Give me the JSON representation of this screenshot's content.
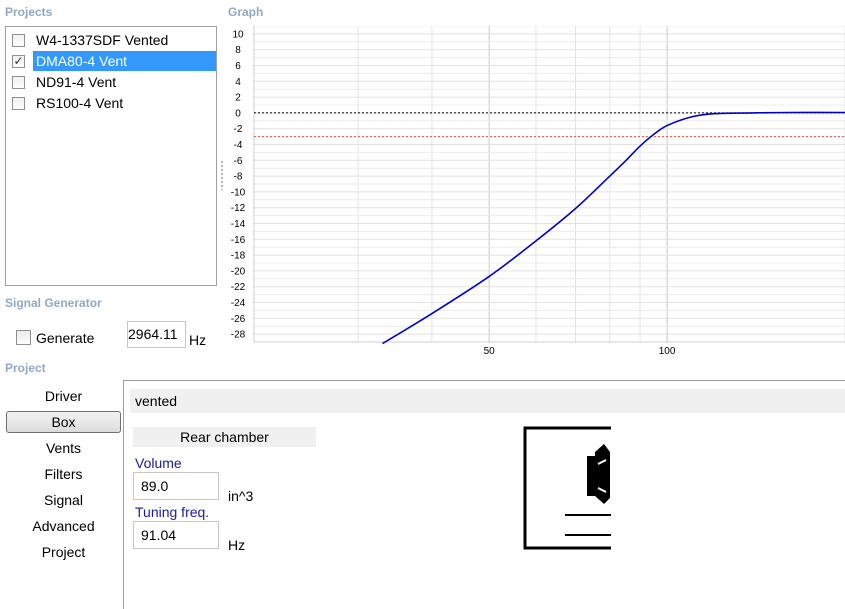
{
  "sections": {
    "projects": "Projects",
    "graph": "Graph",
    "signal_generator": "Signal Generator",
    "project": "Project"
  },
  "projects": [
    {
      "name": "W4-1337SDF Vented",
      "checked": false,
      "selected": false
    },
    {
      "name": "DMA80-4 Vent",
      "checked": true,
      "selected": true
    },
    {
      "name": "ND91-4 Vent",
      "checked": false,
      "selected": false
    },
    {
      "name": "RS100-4 Vent",
      "checked": false,
      "selected": false
    }
  ],
  "signal_generator": {
    "generate_label": "Generate",
    "generate_checked": false,
    "frequency_value": "2964.11",
    "frequency_unit": "Hz"
  },
  "nav": {
    "items": [
      "Driver",
      "Box",
      "Vents",
      "Filters",
      "Signal",
      "Advanced",
      "Project"
    ],
    "active": "Box"
  },
  "box": {
    "type": "vented",
    "chamber_header": "Rear chamber",
    "volume_label": "Volume",
    "volume_value": "89.0",
    "volume_unit": "in^3",
    "tuning_label": "Tuning freq.",
    "tuning_value": "91.04",
    "tuning_unit": "Hz"
  },
  "colors": {
    "response_line": "#0000cc",
    "zero_reference": "#000000",
    "minus3_reference": "#e05a3a",
    "section_title": "#8fa9c7",
    "selection": "#3399ff"
  },
  "chart_data": {
    "type": "line",
    "title": "Graph",
    "x_scale": "log",
    "xlim": [
      20,
      200
    ],
    "ylim": [
      -29,
      11
    ],
    "x_ticks": [
      50,
      100
    ],
    "y_ticks": [
      10,
      8,
      6,
      4,
      2,
      0,
      -2,
      -4,
      -6,
      -8,
      -10,
      -12,
      -14,
      -16,
      -18,
      -20,
      -22,
      -24,
      -26,
      -28
    ],
    "reference_lines": [
      {
        "y": 0,
        "style": "dotted-black"
      },
      {
        "y": -3,
        "style": "dotted-red"
      }
    ],
    "series": [
      {
        "x": [
          33,
          40,
          50,
          60,
          70,
          80,
          85,
          90,
          95,
          100,
          110,
          120,
          140,
          160,
          200
        ],
        "y": [
          -29.2,
          -25.4,
          -20.7,
          -16.2,
          -12.1,
          -8.0,
          -6.1,
          -4.2,
          -2.7,
          -1.6,
          -0.5,
          -0.1,
          0.0,
          0.05,
          0.05
        ]
      }
    ]
  }
}
